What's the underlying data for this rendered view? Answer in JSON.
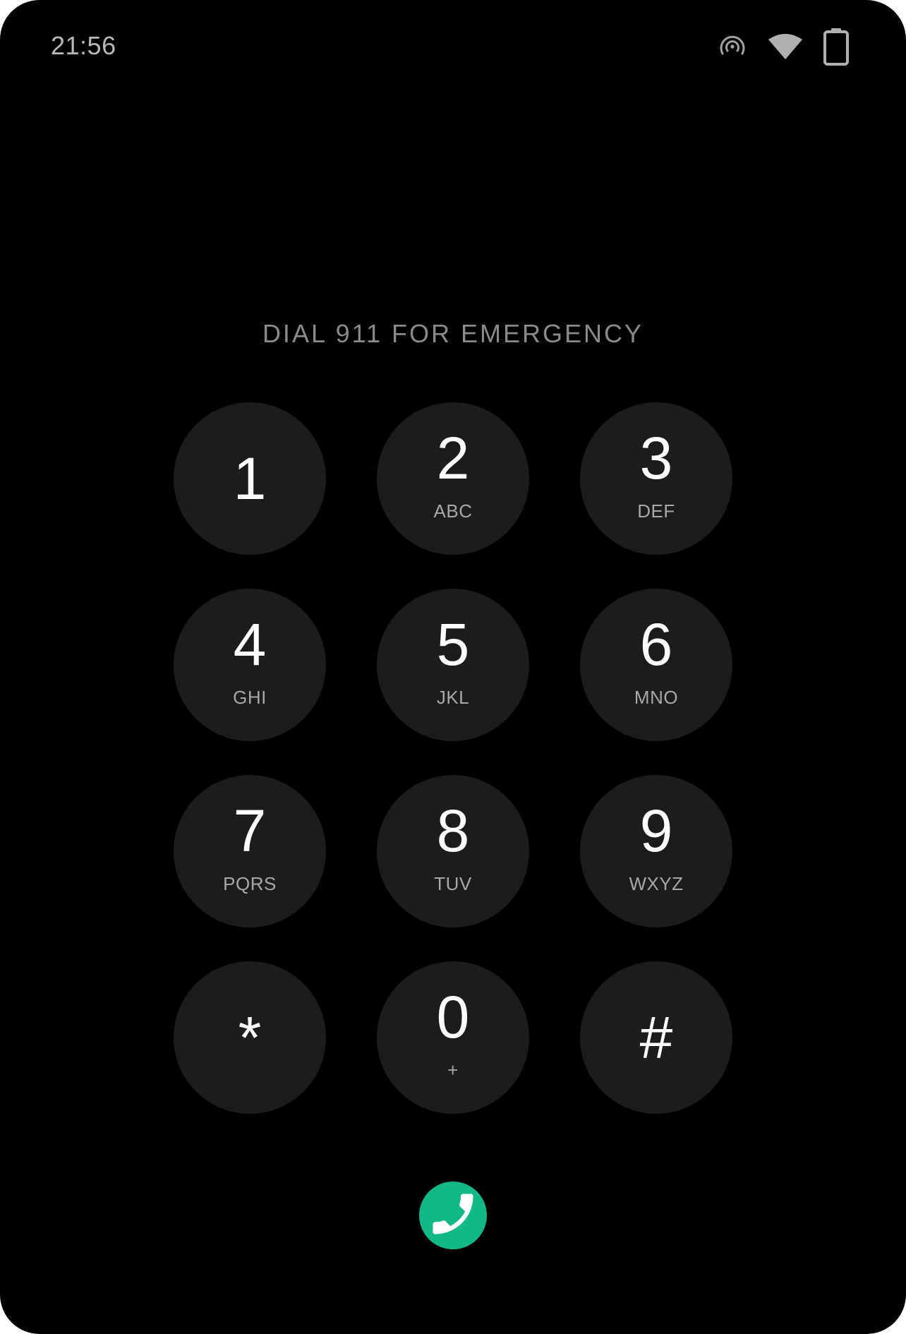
{
  "status_bar": {
    "time": "21:56",
    "icons": [
      "hotspot-icon",
      "wifi-icon",
      "battery-icon"
    ]
  },
  "emergency_label": "DIAL 911 FOR EMERGENCY",
  "keypad": {
    "keys": [
      {
        "digit": "1",
        "letters": ""
      },
      {
        "digit": "2",
        "letters": "ABC"
      },
      {
        "digit": "3",
        "letters": "DEF"
      },
      {
        "digit": "4",
        "letters": "GHI"
      },
      {
        "digit": "5",
        "letters": "JKL"
      },
      {
        "digit": "6",
        "letters": "MNO"
      },
      {
        "digit": "7",
        "letters": "PQRS"
      },
      {
        "digit": "8",
        "letters": "TUV"
      },
      {
        "digit": "9",
        "letters": "WXYZ"
      },
      {
        "digit": "*",
        "letters": ""
      },
      {
        "digit": "0",
        "letters": "+"
      },
      {
        "digit": "#",
        "letters": ""
      }
    ]
  },
  "call_button": {
    "icon": "phone-icon",
    "color": "#12b886"
  },
  "colors": {
    "background": "#000000",
    "key_background": "#1c1c1e",
    "digit_text": "#ffffff",
    "letters_text": "#a8a8a8",
    "label_text": "#8a8a8a"
  }
}
